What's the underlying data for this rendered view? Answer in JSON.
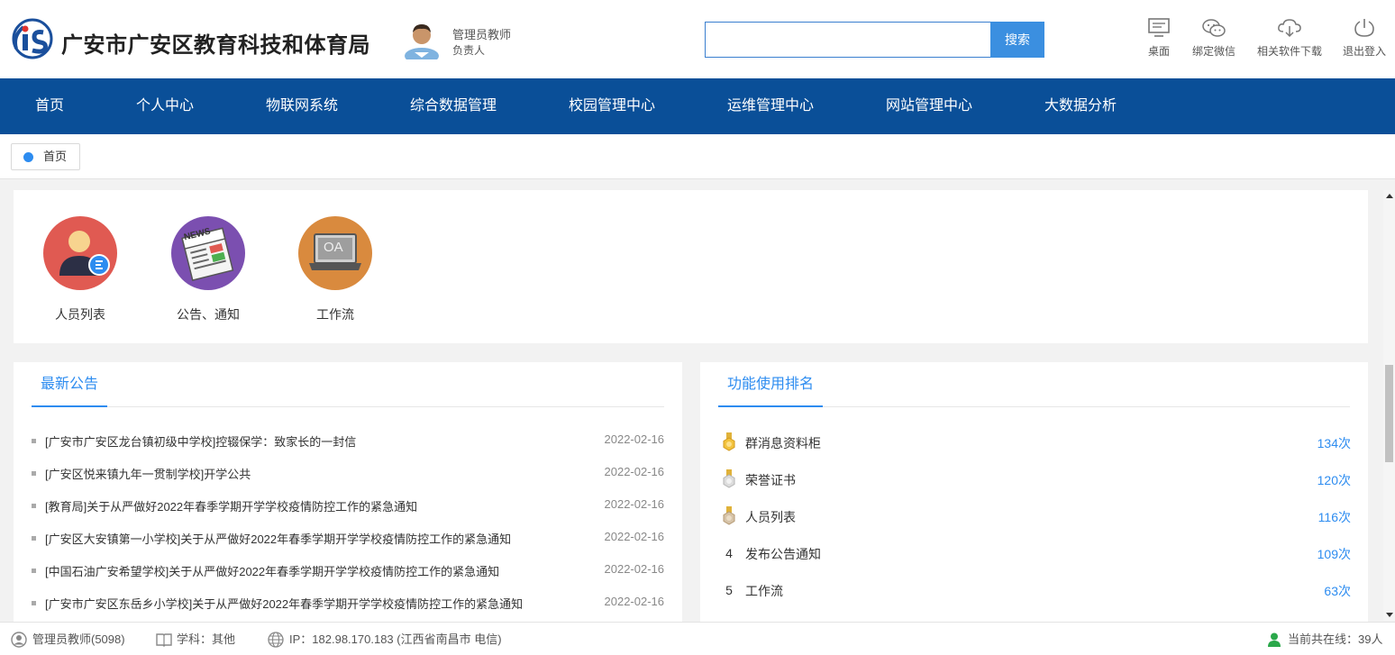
{
  "header": {
    "site_title": "广安市广安区教育科技和体育局",
    "logo_icon": "is-logo-icon",
    "user": {
      "name": "管理员教师",
      "role": "负责人"
    },
    "search": {
      "placeholder": "",
      "value": "",
      "button_label": "搜索"
    },
    "tools": [
      {
        "label": "桌面",
        "icon": "desktop-icon"
      },
      {
        "label": "绑定微信",
        "icon": "wechat-icon"
      },
      {
        "label": "相关软件下载",
        "icon": "cloud-download-icon"
      },
      {
        "label": "退出登入",
        "icon": "power-icon"
      }
    ]
  },
  "nav": {
    "items": [
      "首页",
      "个人中心",
      "物联网系统",
      "综合数据管理",
      "校园管理中心",
      "运维管理中心",
      "网站管理中心",
      "大数据分析"
    ]
  },
  "breadcrumb": {
    "tab_label": "首页"
  },
  "shortcuts": [
    {
      "label": "人员列表",
      "icon": "user-list-icon",
      "color": "#e05a52"
    },
    {
      "label": "公告、通知",
      "icon": "news-icon",
      "color": "#7b4fb0"
    },
    {
      "label": "工作流",
      "icon": "oa-laptop-icon",
      "color": "#d98a3e",
      "badge_text": "OA"
    }
  ],
  "notices": {
    "title": "最新公告",
    "items": [
      {
        "text": "[广安市广安区龙台镇初级中学校]控辍保学：致家长的一封信",
        "date": "2022-02-16"
      },
      {
        "text": "[广安区悦来镇九年一贯制学校]开学公共",
        "date": "2022-02-16"
      },
      {
        "text": "[教育局]关于从严做好2022年春季学期开学学校疫情防控工作的紧急通知",
        "date": "2022-02-16"
      },
      {
        "text": "[广安区大安镇第一小学校]关于从严做好2022年春季学期开学学校疫情防控工作的紧急通知",
        "date": "2022-02-16"
      },
      {
        "text": "[中国石油广安希望学校]关于从严做好2022年春季学期开学学校疫情防控工作的紧急通知",
        "date": "2022-02-16"
      },
      {
        "text": "[广安市广安区东岳乡小学校]关于从严做好2022年春季学期开学学校疫情防控工作的紧急通知",
        "date": "2022-02-16"
      }
    ]
  },
  "ranking": {
    "title": "功能使用排名",
    "items": [
      {
        "rank": "1",
        "badge": "gold-medal-icon",
        "label": "群消息资料柜",
        "count": "134次"
      },
      {
        "rank": "2",
        "badge": "silver-medal-icon",
        "label": "荣誉证书",
        "count": "120次"
      },
      {
        "rank": "3",
        "badge": "bronze-medal-icon",
        "label": "人员列表",
        "count": "116次"
      },
      {
        "rank": "4",
        "badge": "",
        "label": "发布公告通知",
        "count": "109次"
      },
      {
        "rank": "5",
        "badge": "",
        "label": "工作流",
        "count": "63次"
      }
    ]
  },
  "footer": {
    "user": "管理员教师(5098)",
    "subject": "学科：其他",
    "ip": "IP：182.98.170.183 (江西省南昌市 电信)",
    "online": "当前共在线：39人"
  },
  "colors": {
    "nav_bg": "#0a4f98",
    "accent": "#2d8cf0",
    "search_button": "#3b8fe0",
    "online_icon": "#2aa84a"
  }
}
